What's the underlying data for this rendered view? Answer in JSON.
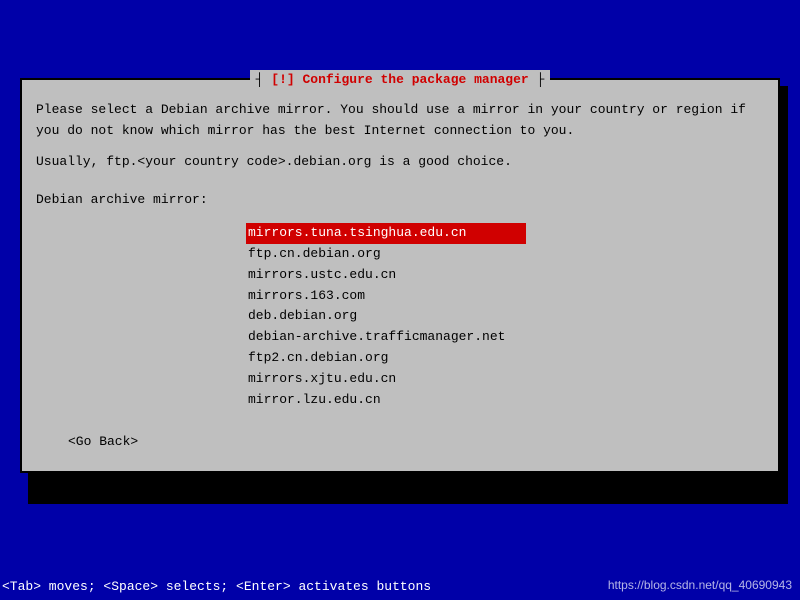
{
  "dialog": {
    "title": "[!] Configure the package manager",
    "para1": "Please select a Debian archive mirror. You should use a mirror in your country or region if you do not know which mirror has the best Internet connection to you.",
    "para2": "Usually, ftp.<your country code>.debian.org is a good choice.",
    "label": "Debian archive mirror:",
    "mirrors": [
      "mirrors.tuna.tsinghua.edu.cn",
      "ftp.cn.debian.org",
      "mirrors.ustc.edu.cn",
      "mirrors.163.com",
      "deb.debian.org",
      "debian-archive.trafficmanager.net",
      "ftp2.cn.debian.org",
      "mirrors.xjtu.edu.cn",
      "mirror.lzu.edu.cn"
    ],
    "selected_index": 0,
    "goback": "<Go Back>"
  },
  "hint": "<Tab> moves; <Space> selects; <Enter> activates buttons",
  "watermark": "https://blog.csdn.net/qq_40690943"
}
